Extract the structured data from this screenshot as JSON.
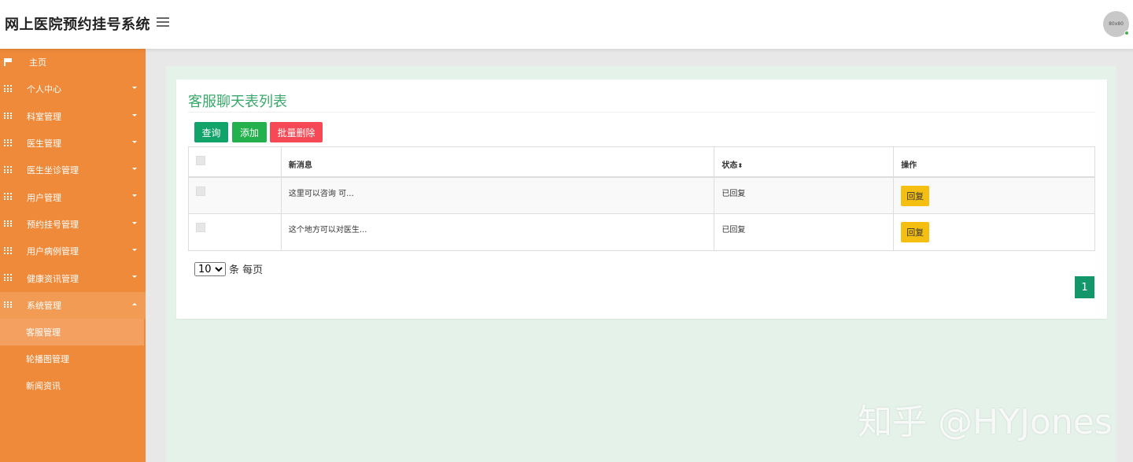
{
  "header": {
    "app_title": "网上医院预约挂号系统",
    "avatar_text": "80x80"
  },
  "sidebar": {
    "items": [
      {
        "label": "主页"
      },
      {
        "label": "个人中心"
      },
      {
        "label": "科室管理"
      },
      {
        "label": "医生管理"
      },
      {
        "label": "医生坐诊管理"
      },
      {
        "label": "用户管理"
      },
      {
        "label": "预约挂号管理"
      },
      {
        "label": "用户病例管理"
      },
      {
        "label": "健康资讯管理"
      },
      {
        "label": "系统管理"
      }
    ],
    "sub_items": [
      {
        "label": "客服管理"
      },
      {
        "label": "轮播图管理"
      },
      {
        "label": "新闻资讯"
      }
    ]
  },
  "main": {
    "title": "客服聊天表列表",
    "buttons": {
      "query": "查询",
      "add": "添加",
      "batch_delete": "批量删除"
    },
    "table": {
      "headers": [
        "新消息",
        "状态",
        "操作"
      ],
      "rows": [
        {
          "message": "这里可以咨询 可...",
          "status": "已回复",
          "action": "回复"
        },
        {
          "message": "这个地方可以对医生...",
          "status": "已回复",
          "action": "回复"
        }
      ]
    },
    "pagination": {
      "page_size": "10",
      "page_size_suffix": "条 每页",
      "current_page": "1"
    }
  },
  "watermark": "知乎 @HYJones",
  "colors": {
    "sidebar": "#ef8a3a",
    "primary_green": "#11a36a",
    "danger": "#f54a55",
    "warning": "#f5bf12",
    "title_green": "#3aa86b"
  }
}
